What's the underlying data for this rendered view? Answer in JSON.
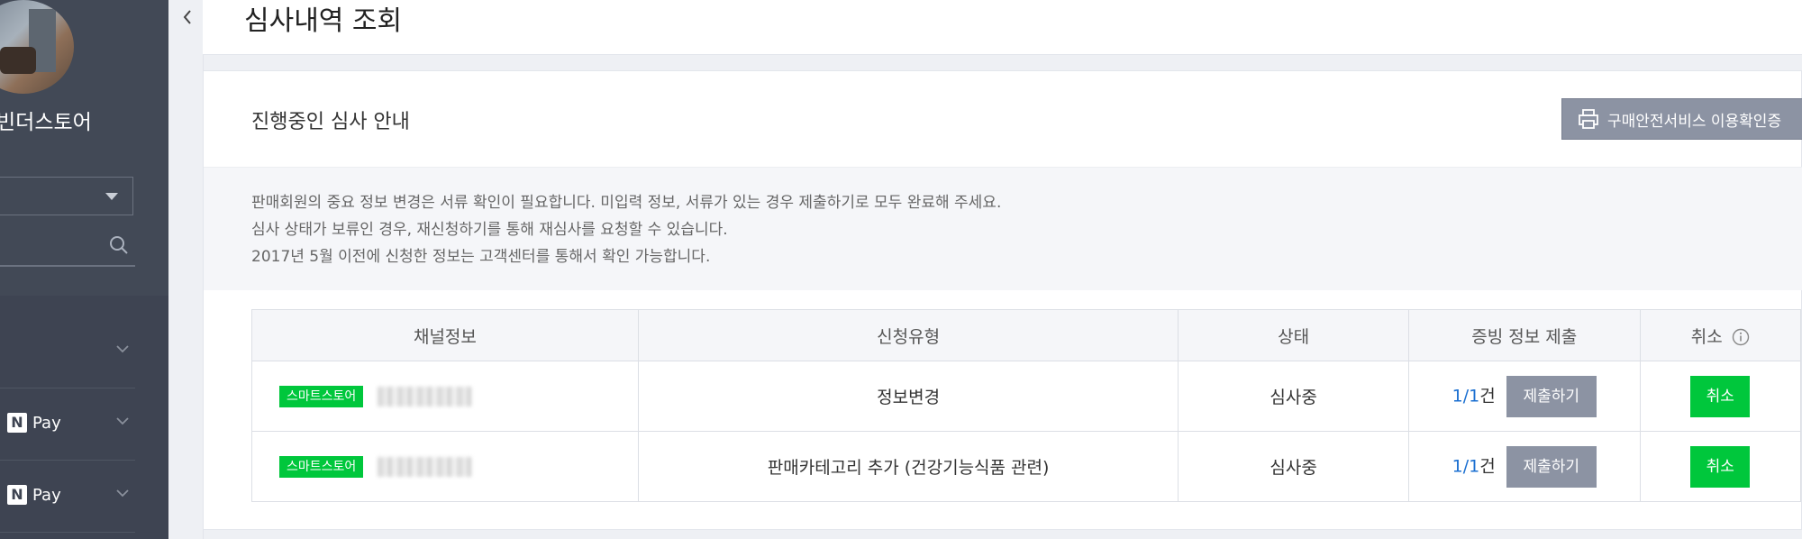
{
  "sidebar": {
    "store_name": "빈더스토어",
    "menu": [
      {
        "label": ""
      },
      {
        "label": "Pay",
        "logo_letter": "N"
      },
      {
        "label": "Pay",
        "logo_letter": "N"
      }
    ]
  },
  "header": {
    "title": "심사내역 조회"
  },
  "card": {
    "title": "진행중인 심사 안내",
    "print_button": "구매안전서비스 이용확인증",
    "notices": [
      "판매회원의 중요 정보 변경은 서류 확인이 필요합니다. 미입력 정보, 서류가 있는 경우 제출하기로 모두 완료해 주세요.",
      "심사 상태가 보류인 경우, 재신청하기를 통해 재심사를 요청할 수 있습니다.",
      "2017년 5월 이전에 신청한 정보는 고객센터를 통해서 확인 가능합니다."
    ]
  },
  "table": {
    "headers": [
      "채널정보",
      "신청유형",
      "상태",
      "증빙 정보 제출",
      "취소"
    ],
    "rows": [
      {
        "channel_tag": "스마트스토어",
        "type": "정보변경",
        "status": "심사중",
        "count": "1/1",
        "count_unit": "건",
        "submit": "제출하기",
        "cancel": "취소"
      },
      {
        "channel_tag": "스마트스토어",
        "type": "판매카테고리 추가 (건강기능식품 관련)",
        "status": "심사중",
        "count": "1/1",
        "count_unit": "건",
        "submit": "제출하기",
        "cancel": "취소"
      }
    ]
  },
  "colors": {
    "accent_green": "#00c73c",
    "sidebar_bg": "#3e4452",
    "button_gray": "#8c93a3",
    "link_blue": "#1a6fd1"
  }
}
